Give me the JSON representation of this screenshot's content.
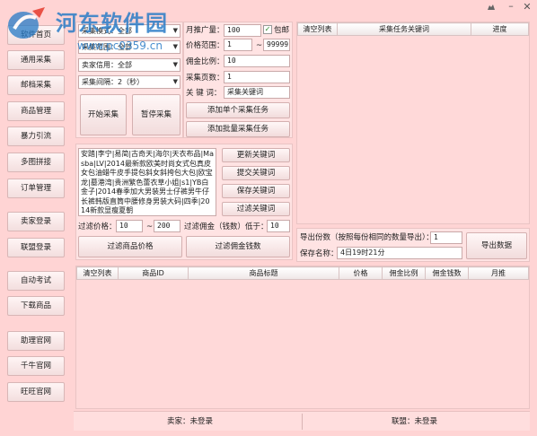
{
  "watermark": {
    "title": "河东软件园",
    "url": "www.pc0359.cn"
  },
  "sidebar": {
    "items": [
      {
        "label": "软件首页"
      },
      {
        "label": "通用采集"
      },
      {
        "label": "邮档采集"
      },
      {
        "label": "商品管理"
      },
      {
        "label": "暴力引流"
      },
      {
        "label": "多图拼接"
      },
      {
        "label": "订单管理"
      },
      {
        "label": "卖家登录"
      },
      {
        "label": "联盟登录"
      },
      {
        "label": "自动考试"
      },
      {
        "label": "下载商品"
      },
      {
        "label": "助理官网"
      },
      {
        "label": "千牛官网"
      },
      {
        "label": "旺旺官网"
      }
    ]
  },
  "collect": {
    "mode_select": "采集模式：全部",
    "range_select": "采集范围：全部",
    "credit_select": "卖家信用：全部",
    "interval_select": "采集间隔：2（秒）",
    "start_btn": "开始采集",
    "pause_btn": "暂停采集",
    "monthly_label": "月推广量：",
    "monthly_value": "100",
    "baoyou_label": "包邮",
    "price_label": "价格范围：",
    "price_min": "1",
    "price_sep": "~",
    "price_max": "99999",
    "commission_label": "佣金比例：",
    "commission_value": "10",
    "pages_label": "采集页数：",
    "pages_value": "1",
    "keyword_label": "关 键 词：",
    "keyword_value": "采集关键词",
    "add_single_btn": "添加单个采集任务",
    "add_batch_btn": "添加批量采集任务"
  },
  "task_table": {
    "headers": [
      "清空列表",
      "采集任务关键词",
      "进度"
    ]
  },
  "keywords": {
    "text": "安踏|李宁|易简|古奇天|海尔|天衣布品|Masba|LV|2014最新款欧美时尚女式包真皮女包油蜡牛皮手提包斜女斜挎包大包|欧宝龙|墓港湾|贵洲繁色蕾衣草小姐|s1|YB白金子|2014春季加大男装男士仔裤男牛仔长裤韩版直筒中腰修身男装大码|四季|2014新款显瘦夏朝",
    "update_btn": "更新关键词",
    "submit_btn": "提交关键词",
    "save_btn": "保存关键词",
    "filter_btn": "过滤关键词",
    "filter_price_label": "过滤价格：",
    "filter_price_min": "10",
    "filter_price_sep": "~",
    "filter_price_max": "200",
    "filter_commission_label": "过滤佣金（钱数）低于：",
    "filter_commission_value": "10",
    "filter_price_btn": "过滤商品价格",
    "filter_commission_btn": "过滤佣金钱数"
  },
  "export": {
    "count_label": "导出份数（按照每份相同的数量导出）：",
    "count_value": "1",
    "save_label": "保存名称：",
    "save_value": "4日19时21分",
    "export_btn": "导出数据"
  },
  "product_table": {
    "headers": [
      "清空列表",
      "商品ID",
      "商品标题",
      "价格",
      "佣金比例",
      "佣金钱数",
      "月推"
    ]
  },
  "status": {
    "seller": "卖家：未登录",
    "alliance": "联盟：未登录"
  }
}
